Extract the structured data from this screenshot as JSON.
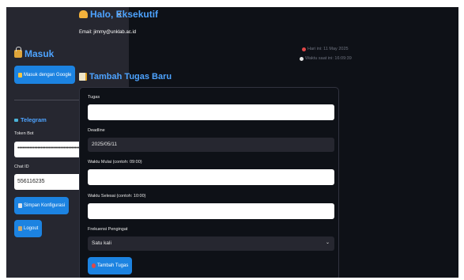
{
  "sidebar": {
    "close_symbol": "×",
    "login_title": "Masuk",
    "google_button": "Masuk dengan Google",
    "telegram_title": "Telegram",
    "token_label": "Token Bot",
    "token_value": "••••••••••••••••••••••••••••••••••••••••••",
    "chat_id_label": "Chat ID",
    "chat_id_value": "556116235",
    "save_button": "Simpan Konfigurasi",
    "logout_button": "Logout"
  },
  "main": {
    "greeting": "Halo, Eksekutif",
    "email": "Email: jimmy@unklab.ac.id",
    "date_text": "Hari ini: 11 May 2025",
    "time_text": "Waktu saat ini: 16:09:39",
    "form_title": "Tambah Tugas Baru",
    "task_label": "Tugas",
    "deadline_label": "Deadline",
    "deadline_value": "2025/05/11",
    "start_label": "Waktu Mulai (contoh: 09:00)",
    "end_label": "Waktu Selesai (contoh: 10:00)",
    "freq_label": "Frekuensi Pengingat",
    "freq_value": "Satu kali",
    "submit_button": "Tambah Tugas"
  },
  "icons": {
    "login": "lock-key-icon",
    "google_button": "key-icon",
    "telegram": "telegram-icon",
    "eye": "eye-icon",
    "save": "save-icon",
    "logout": "door-icon",
    "greeting": "wave-hand-icon",
    "date": "alarm-clock-icon",
    "time": "clock-icon",
    "form": "memo-icon",
    "submit": "pushpin-icon",
    "dropdown": "chevron-down-icon"
  },
  "colors": {
    "accent": "#4da3ff",
    "button": "#1c83e1",
    "sidebar_bg": "#262730",
    "main_bg": "#0e1117"
  }
}
